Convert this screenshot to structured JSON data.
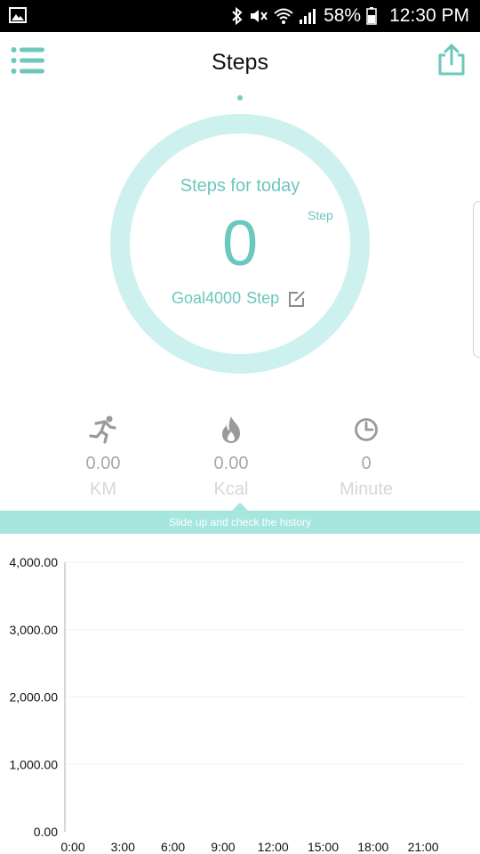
{
  "status_bar": {
    "battery": "58%",
    "time": "12:30 PM",
    "icons": [
      "gallery-icon",
      "bluetooth-icon",
      "mute-icon",
      "wifi-icon",
      "signal-icon",
      "battery-icon"
    ]
  },
  "header": {
    "title": "Steps",
    "left_icon": "list-menu-icon",
    "right_icon": "share-icon"
  },
  "today": {
    "caption": "Steps for today",
    "unit": "Step",
    "value": "0",
    "goal_label": "Goal",
    "goal_value": "4000",
    "goal_unit": "Step",
    "edit_icon": "edit-icon"
  },
  "stats": [
    {
      "icon": "running-icon",
      "value": "0.00",
      "unit": "KM"
    },
    {
      "icon": "flame-icon",
      "value": "0.00",
      "unit": "Kcal"
    },
    {
      "icon": "clock-icon",
      "value": "0",
      "unit": "Minute"
    }
  ],
  "banner": {
    "text": "Slide up and check the history"
  },
  "colors": {
    "accent": "#6cc7bd",
    "ring": "#cdf1ef",
    "banner": "#a6e6df",
    "stat_value": "#a8a8a8",
    "stat_unit": "#d7d7d7"
  },
  "chart_data": {
    "type": "bar",
    "x_ticks": [
      "0:00",
      "3:00",
      "6:00",
      "9:00",
      "12:00",
      "15:00",
      "18:00",
      "21:00"
    ],
    "y_ticks": [
      "0.00",
      "1,000.00",
      "2,000.00",
      "3,000.00",
      "4,000.00"
    ],
    "ylim": [
      0,
      4000
    ],
    "values": [],
    "grid": true
  }
}
